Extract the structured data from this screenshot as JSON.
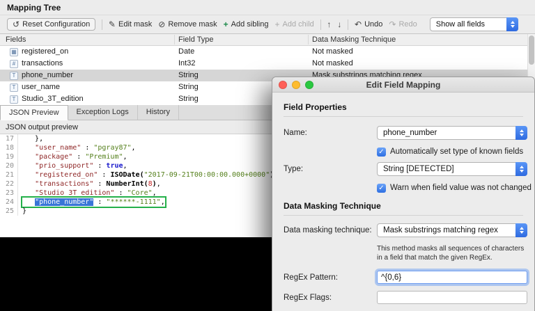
{
  "window": {
    "title": "Mapping Tree",
    "toolbar": {
      "reset": "Reset Configuration",
      "edit_mask": "Edit mask",
      "remove_mask": "Remove mask",
      "add_sibling": "Add sibling",
      "add_child": "Add child",
      "undo": "Undo",
      "redo": "Redo",
      "fields_filter": "Show all fields"
    },
    "table": {
      "columns": [
        "Fields",
        "Field Type",
        "Data Masking Technique"
      ],
      "rows": [
        {
          "field": "registered_on",
          "type": "Date",
          "technique": "Not masked",
          "icon": "▦"
        },
        {
          "field": "transactions",
          "type": "Int32",
          "technique": "Not masked",
          "icon": "#"
        },
        {
          "field": "phone_number",
          "type": "String",
          "technique": "Mask substrings matching regex",
          "icon": "T"
        },
        {
          "field": "user_name",
          "type": "String",
          "technique": "",
          "icon": "T"
        },
        {
          "field": "Studio_3T_edition",
          "type": "String",
          "technique": "",
          "icon": "T"
        }
      ]
    },
    "tabs": [
      "JSON Preview",
      "Exception Logs",
      "History"
    ],
    "preview_label": "JSON output preview",
    "code": {
      "lines": [
        {
          "num": "17",
          "hl": false,
          "segs": [
            [
              "p",
              "   },"
            ]
          ]
        },
        {
          "num": "18",
          "hl": false,
          "segs": [
            [
              "p",
              "   "
            ],
            [
              "k",
              "\"user_name\""
            ],
            [
              "p",
              " : "
            ],
            [
              "s",
              "\"pgray87\""
            ],
            [
              "p",
              ","
            ]
          ]
        },
        {
          "num": "19",
          "hl": false,
          "segs": [
            [
              "p",
              "   "
            ],
            [
              "k",
              "\"package\""
            ],
            [
              "p",
              " : "
            ],
            [
              "s",
              "\"Premium\""
            ],
            [
              "p",
              ","
            ]
          ]
        },
        {
          "num": "20",
          "hl": false,
          "segs": [
            [
              "p",
              "   "
            ],
            [
              "k",
              "\"prio_support\""
            ],
            [
              "p",
              " : "
            ],
            [
              "b",
              "true"
            ],
            [
              "p",
              ","
            ]
          ]
        },
        {
          "num": "21",
          "hl": false,
          "segs": [
            [
              "p",
              "   "
            ],
            [
              "k",
              "\"registered_on\""
            ],
            [
              "p",
              " : "
            ],
            [
              "f",
              "ISODate("
            ],
            [
              "s",
              "\"2017-09-21T00:00:00.000+0000\""
            ],
            [
              "f",
              ")"
            ],
            [
              "p",
              ","
            ]
          ]
        },
        {
          "num": "22",
          "hl": false,
          "segs": [
            [
              "p",
              "   "
            ],
            [
              "k",
              "\"transactions\""
            ],
            [
              "p",
              " : "
            ],
            [
              "f",
              "NumberInt("
            ],
            [
              "n",
              "8"
            ],
            [
              "f",
              ")"
            ],
            [
              "p",
              ","
            ]
          ]
        },
        {
          "num": "23",
          "hl": false,
          "segs": [
            [
              "p",
              "   "
            ],
            [
              "k",
              "\"Studio_3T edition\""
            ],
            [
              "p",
              " : "
            ],
            [
              "s",
              "\"Core\""
            ],
            [
              "p",
              ","
            ]
          ]
        },
        {
          "num": "24",
          "hl": true,
          "segs": [
            [
              "p",
              "   "
            ],
            [
              "ksel",
              "\"phone_number\""
            ],
            [
              "p",
              " : "
            ],
            [
              "s",
              "\"******-1111\""
            ],
            [
              "p",
              ","
            ]
          ]
        },
        {
          "num": "25",
          "hl": false,
          "segs": [
            [
              "p",
              "}"
            ]
          ]
        }
      ]
    }
  },
  "dialog": {
    "title": "Edit Field Mapping",
    "sections": {
      "properties": "Field Properties",
      "masking": "Data Masking Technique"
    },
    "name_label": "Name:",
    "name_value": "phone_number",
    "auto_type_label": "Automatically set type of known fields",
    "type_label": "Type:",
    "type_value": "String [DETECTED]",
    "warn_label": "Warn when field value was not changed",
    "technique_label": "Data masking technique:",
    "technique_value": "Mask substrings matching regex",
    "technique_help": [
      "This method masks all sequences of characters",
      "in a field that match the given RegEx."
    ],
    "regex_pattern_label": "RegEx Pattern:",
    "regex_pattern_value": "^{0,6}",
    "regex_flags_label": "RegEx Flags:",
    "regex_flags_value": ""
  },
  "icons": {
    "reset": "↺",
    "edit": "✎",
    "remove": "⊘",
    "add": "+",
    "up": "↑",
    "down": "↓",
    "undo": "↶",
    "redo": "↷",
    "check": "✓"
  },
  "colors": {
    "accent_blue": "#3875d7",
    "highlight_green": "#24b04a",
    "selection_gray": "#d6d6d6",
    "key_maroon": "#8f2727",
    "string_green": "#55801c",
    "traffic_red": "#ff5f57",
    "traffic_yellow": "#febc2e",
    "traffic_green": "#2ac840"
  }
}
